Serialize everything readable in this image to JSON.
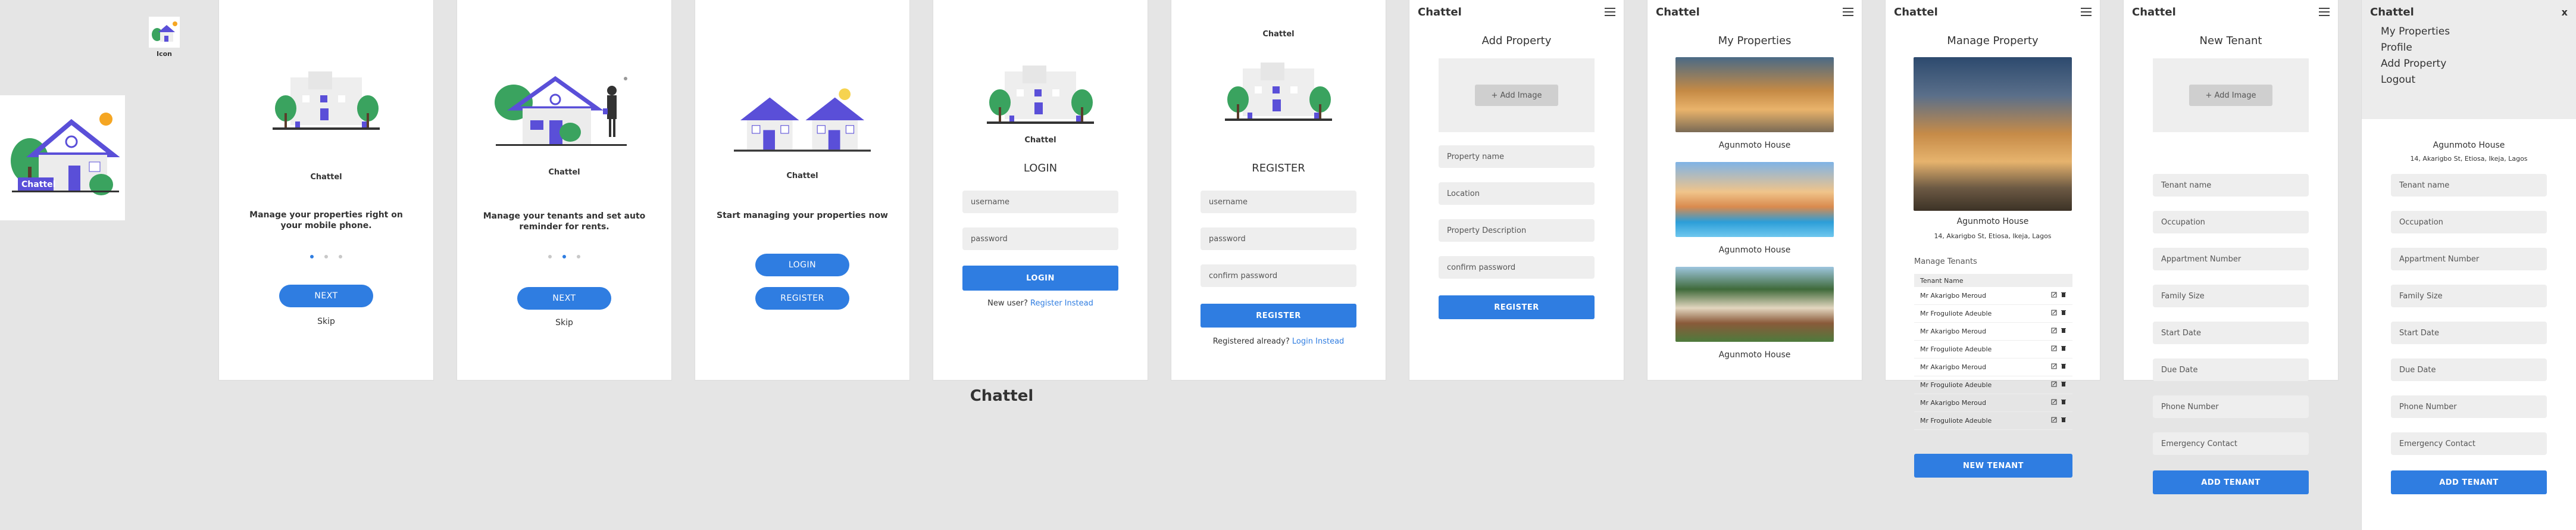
{
  "canvas_title": "Chattel",
  "icon_card": {
    "label": "Icon"
  },
  "logo": {
    "text": "Chattel"
  },
  "onboard1": {
    "brand": "Chattel",
    "message": "Manage your properties right on your mobile phone.",
    "next": "NEXT",
    "skip": "Skip"
  },
  "onboard2": {
    "brand": "Chattel",
    "message": "Manage your tenants and set auto reminder for rents.",
    "next": "NEXT",
    "skip": "Skip"
  },
  "onboard3": {
    "brand": "Chattel",
    "message": "Start managing your properties now",
    "login": "LOGIN",
    "register": "REGISTER"
  },
  "login": {
    "brand": "Chattel",
    "heading": "LOGIN",
    "username_ph": "username",
    "password_ph": "password",
    "button": "LOGIN",
    "prompt": "New user?",
    "link": "Register Instead"
  },
  "register": {
    "brand": "Chattel",
    "heading": "REGISTER",
    "username_ph": "username",
    "password_ph": "password",
    "confirm_ph": "confirm password",
    "button": "REGISTER",
    "prompt": "Registered already?",
    "link": "Login Instead"
  },
  "add_property": {
    "app": "Chattel",
    "title": "Add Property",
    "add_image": "+ Add Image",
    "name_ph": "Property name",
    "location_ph": "Location",
    "desc_ph": "Property Description",
    "confirm_ph": "confirm password",
    "button": "REGISTER"
  },
  "my_properties": {
    "app": "Chattel",
    "title": "My Properties",
    "items": [
      {
        "name": "Agunmoto House"
      },
      {
        "name": "Agunmoto House"
      },
      {
        "name": "Agunmoto House"
      }
    ]
  },
  "manage_property": {
    "app": "Chattel",
    "title": "Manage Property",
    "name": "Agunmoto House",
    "address": "14, Akarigbo St, Etiosa, Ikeja, Lagos",
    "section": "Manage Tenants",
    "col_header": "Tenant Name",
    "tenants": [
      "Mr Akarigbo Meroud",
      "Mr Froguliote Adeuble",
      "Mr Akarigbo Meroud",
      "Mr Froguliote Adeuble",
      "Mr Akarigbo Meroud",
      "Mr Froguliote Adeuble",
      "Mr Akarigbo Meroud",
      "Mr Froguliote Adeuble"
    ],
    "button": "NEW TENANT"
  },
  "new_tenant": {
    "app": "Chattel",
    "title": "New Tenant",
    "add_image": "+ Add Image",
    "fields": [
      "Tenant name",
      "Occupation",
      "Appartment Number",
      "Family Size",
      "Start Date",
      "Due Date",
      "Phone Number",
      "Emergency Contact"
    ],
    "button": "ADD TENANT"
  },
  "menu_screen": {
    "app": "Chattel",
    "close": "x",
    "menu": [
      "My Properties",
      "Profile",
      "Add Property",
      "Logout"
    ],
    "name": "Agunmoto House",
    "address": "14, Akarigbo St, Etiosa, Ikeja, Lagos",
    "fields": [
      "Tenant name",
      "Occupation",
      "Appartment Number",
      "Family Size",
      "Start Date",
      "Due Date",
      "Phone Number",
      "Emergency Contact"
    ],
    "button": "ADD TENANT"
  },
  "colors": {
    "accent": "#2f7de1",
    "brand_purple": "#5a4fd8",
    "tree_green": "#3aa35f"
  }
}
